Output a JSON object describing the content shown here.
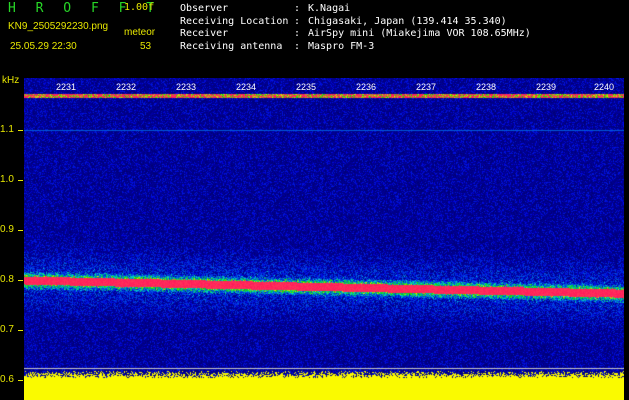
{
  "header": {
    "app_title": "H R O F F T",
    "version": "1.00f",
    "file_name": "KN9_2505292230.png",
    "datetime": "25.05.29 22:30",
    "meteor_label": "meteor",
    "meteor_count": "53",
    "info": [
      {
        "key": "Observer",
        "value": "K.Nagai"
      },
      {
        "key": "Receiving Location",
        "value": "Chigasaki, Japan (139.414 35.340)"
      },
      {
        "key": "Receiver",
        "value": "AirSpy mini (Miakejima VOR 108.65MHz)"
      },
      {
        "key": "Receiving antenna",
        "value": "Maspro FM-3"
      }
    ]
  },
  "spectrogram": {
    "y_unit": "kHz",
    "y_labels": [
      "1.1",
      "1.0",
      "0.9",
      "0.8",
      "0.7",
      "0.6"
    ],
    "x_labels": [
      "2231",
      "2232",
      "2233",
      "2234",
      "2235",
      "2236",
      "2237",
      "2238",
      "2239",
      "2240"
    ],
    "colors": {
      "background": "#000000",
      "noise": "#0a1a8a",
      "signal": "#ff2a60",
      "baseline": "#ffff00"
    }
  }
}
